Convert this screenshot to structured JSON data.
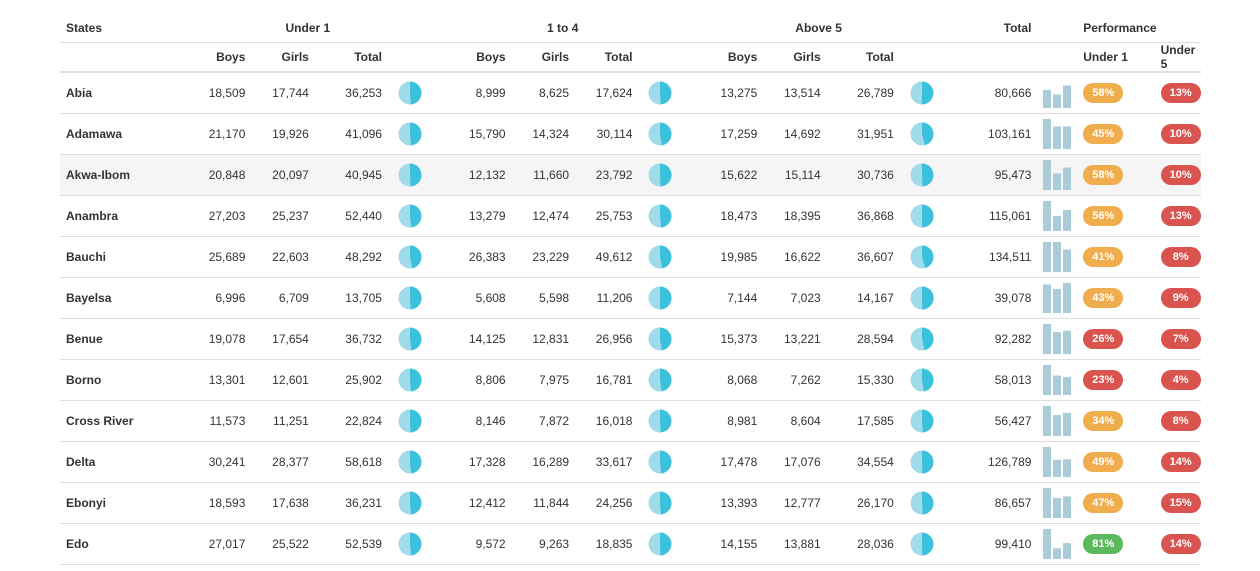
{
  "headers": {
    "states": "States",
    "under1": "Under 1",
    "one_to_four": "1 to 4",
    "above5": "Above 5",
    "total": "Total",
    "performance": "Performance",
    "boys": "Boys",
    "girls": "Girls",
    "total_col": "Total",
    "perf_under1": "Under 1",
    "perf_under5": "Under 5"
  },
  "colors": {
    "pie_light": "#9fdbe8",
    "pie_dark": "#3cc1dd",
    "bar": "#a9ccd8",
    "badge_orange": "#f0ad4e",
    "badge_red": "#d9534f",
    "badge_green": "#5cb85c"
  },
  "rows": [
    {
      "state": "Abia",
      "u1": [
        "18,509",
        "17,744",
        "36,253"
      ],
      "o14": [
        "8,999",
        "8,625",
        "17,624"
      ],
      "a5": [
        "13,275",
        "13,514",
        "26,789"
      ],
      "total": "80,666",
      "perf_u1": "58%",
      "perf_u1_color": "orange",
      "perf_u5": "13%",
      "perf_u5_color": "red",
      "spark": [
        0.6,
        0.45,
        0.75
      ]
    },
    {
      "state": "Adamawa",
      "u1": [
        "21,170",
        "19,926",
        "41,096"
      ],
      "o14": [
        "15,790",
        "14,324",
        "30,114"
      ],
      "a5": [
        "17,259",
        "14,692",
        "31,951"
      ],
      "total": "103,161",
      "perf_u1": "45%",
      "perf_u1_color": "orange",
      "perf_u5": "10%",
      "perf_u5_color": "red",
      "spark": [
        1.0,
        0.75,
        0.75
      ]
    },
    {
      "state": "Akwa-Ibom",
      "u1": [
        "20,848",
        "20,097",
        "40,945"
      ],
      "o14": [
        "12,132",
        "11,660",
        "23,792"
      ],
      "a5": [
        "15,622",
        "15,114",
        "30,736"
      ],
      "total": "95,473",
      "perf_u1": "58%",
      "perf_u1_color": "orange",
      "perf_u5": "10%",
      "perf_u5_color": "red",
      "spark": [
        1.0,
        0.55,
        0.75
      ]
    },
    {
      "state": "Anambra",
      "u1": [
        "27,203",
        "25,237",
        "52,440"
      ],
      "o14": [
        "13,279",
        "12,474",
        "25,753"
      ],
      "a5": [
        "18,473",
        "18,395",
        "36,868"
      ],
      "total": "115,061",
      "perf_u1": "56%",
      "perf_u1_color": "orange",
      "perf_u5": "13%",
      "perf_u5_color": "red",
      "spark": [
        1.0,
        0.5,
        0.7
      ]
    },
    {
      "state": "Bauchi",
      "u1": [
        "25,689",
        "22,603",
        "48,292"
      ],
      "o14": [
        "26,383",
        "23,229",
        "49,612"
      ],
      "a5": [
        "19,985",
        "16,622",
        "36,607"
      ],
      "total": "134,511",
      "perf_u1": "41%",
      "perf_u1_color": "orange",
      "perf_u5": "8%",
      "perf_u5_color": "red",
      "spark": [
        1.0,
        1.0,
        0.75
      ]
    },
    {
      "state": "Bayelsa",
      "u1": [
        "6,996",
        "6,709",
        "13,705"
      ],
      "o14": [
        "5,608",
        "5,598",
        "11,206"
      ],
      "a5": [
        "7,144",
        "7,023",
        "14,167"
      ],
      "total": "39,078",
      "perf_u1": "43%",
      "perf_u1_color": "orange",
      "perf_u5": "9%",
      "perf_u5_color": "red",
      "spark": [
        0.95,
        0.8,
        1.0
      ]
    },
    {
      "state": "Benue",
      "u1": [
        "19,078",
        "17,654",
        "36,732"
      ],
      "o14": [
        "14,125",
        "12,831",
        "26,956"
      ],
      "a5": [
        "15,373",
        "13,221",
        "28,594"
      ],
      "total": "92,282",
      "perf_u1": "26%",
      "perf_u1_color": "red",
      "perf_u5": "7%",
      "perf_u5_color": "red",
      "spark": [
        1.0,
        0.73,
        0.78
      ]
    },
    {
      "state": "Borno",
      "u1": [
        "13,301",
        "12,601",
        "25,902"
      ],
      "o14": [
        "8,806",
        "7,975",
        "16,781"
      ],
      "a5": [
        "8,068",
        "7,262",
        "15,330"
      ],
      "total": "58,013",
      "perf_u1": "23%",
      "perf_u1_color": "red",
      "perf_u5": "4%",
      "perf_u5_color": "red",
      "spark": [
        1.0,
        0.65,
        0.6
      ]
    },
    {
      "state": "Cross River",
      "u1": [
        "11,573",
        "11,251",
        "22,824"
      ],
      "o14": [
        "8,146",
        "7,872",
        "16,018"
      ],
      "a5": [
        "8,981",
        "8,604",
        "17,585"
      ],
      "total": "56,427",
      "perf_u1": "34%",
      "perf_u1_color": "orange",
      "perf_u5": "8%",
      "perf_u5_color": "red",
      "spark": [
        1.0,
        0.7,
        0.77
      ]
    },
    {
      "state": "Delta",
      "u1": [
        "30,241",
        "28,377",
        "58,618"
      ],
      "o14": [
        "17,328",
        "16,289",
        "33,617"
      ],
      "a5": [
        "17,478",
        "17,076",
        "34,554"
      ],
      "total": "126,789",
      "perf_u1": "49%",
      "perf_u1_color": "orange",
      "perf_u5": "14%",
      "perf_u5_color": "red",
      "spark": [
        1.0,
        0.57,
        0.59
      ]
    },
    {
      "state": "Ebonyi",
      "u1": [
        "18,593",
        "17,638",
        "36,231"
      ],
      "o14": [
        "12,412",
        "11,844",
        "24,256"
      ],
      "a5": [
        "13,393",
        "12,777",
        "26,170"
      ],
      "total": "86,657",
      "perf_u1": "47%",
      "perf_u1_color": "orange",
      "perf_u5": "15%",
      "perf_u5_color": "red",
      "spark": [
        1.0,
        0.67,
        0.72
      ]
    },
    {
      "state": "Edo",
      "u1": [
        "27,017",
        "25,522",
        "52,539"
      ],
      "o14": [
        "9,572",
        "9,263",
        "18,835"
      ],
      "a5": [
        "14,155",
        "13,881",
        "28,036"
      ],
      "total": "99,410",
      "perf_u1": "81%",
      "perf_u1_color": "green",
      "perf_u5": "14%",
      "perf_u5_color": "red",
      "spark": [
        1.0,
        0.36,
        0.53
      ]
    }
  ]
}
